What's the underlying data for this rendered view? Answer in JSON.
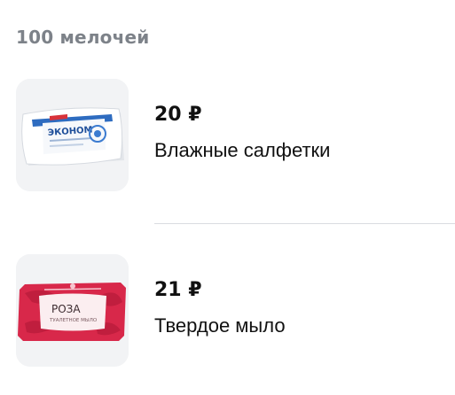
{
  "section": {
    "title": "100 мелочей"
  },
  "products": [
    {
      "price": "20 ₽",
      "name": "Влажные салфетки",
      "image_icon": "wet-wipes-pack-icon",
      "package_text": "ЭКОНОМ"
    },
    {
      "price": "21 ₽",
      "name": "Твердое мыло",
      "image_icon": "soap-bar-icon",
      "package_brand": "РОЗА",
      "package_subtitle": "ТУАЛЕТНОЕ МЫЛО"
    }
  ],
  "colors": {
    "section_title": "#7d8289",
    "text": "#111111",
    "thumb_bg": "#f2f3f5",
    "divider": "#d9dce0",
    "soap_wrapper": "#d8284a"
  }
}
